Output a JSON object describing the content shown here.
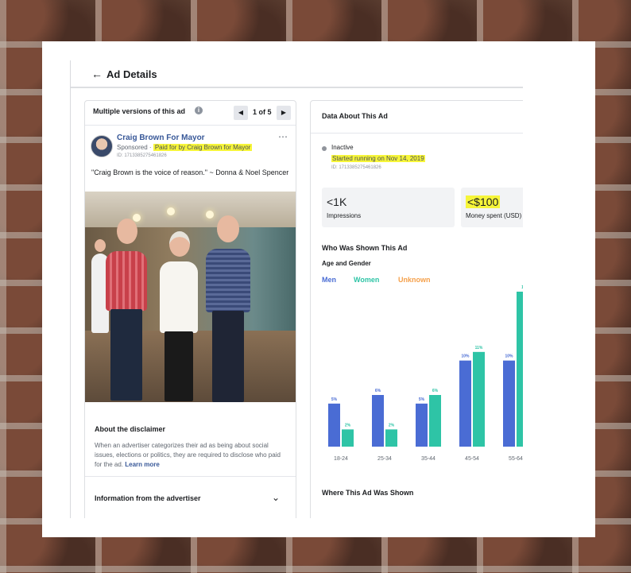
{
  "header": {
    "back_icon": "arrow-left-icon",
    "title": "Ad Details"
  },
  "versions": {
    "label": "Multiple versions of this ad",
    "count": "1 of 5"
  },
  "ad": {
    "advertiser": "Craig Brown For Mayor",
    "sponsored": "Sponsored · ",
    "paid_for": "Paid for by Craig Brown for Mayor",
    "id": "ID: 1713385275461826",
    "text": "\"Craig Brown is the voice of reason.\" ~ Donna & Noel Spencer"
  },
  "disclaimer": {
    "title": "About the disclaimer",
    "body": "When an advertiser categorizes their ad as being about social issues, elections or politics, they are required to disclose who paid for the ad. ",
    "learn_more": "Learn more"
  },
  "advertiser_info": {
    "title": "Information from the advertiser"
  },
  "data_panel": {
    "title": "Data About This Ad",
    "status": "Inactive",
    "started": "Started running on Nov 14, 2019",
    "id": "ID: 1713385275461826",
    "impressions_value": "<1K",
    "impressions_label": "Impressions",
    "spent_value": "<$100",
    "spent_label": "Money spent (USD)",
    "who_title": "Who Was Shown This Ad",
    "age_gender": "Age and Gender",
    "where_title": "Where This Ad Was Shown"
  },
  "legend": {
    "men": "Men",
    "women": "Women",
    "unknown": "Unknown"
  },
  "colors": {
    "men": "#4a6cd4",
    "women": "#2ec4a6",
    "unknown": "#f5a04a",
    "highlight": "#f6f53a"
  },
  "chart_data": {
    "type": "bar",
    "categories": [
      "18-24",
      "25-34",
      "35-44",
      "45-54",
      "55-64"
    ],
    "series": [
      {
        "name": "Men",
        "values": [
          5,
          6,
          5,
          10,
          10
        ],
        "labels": [
          "5%",
          "6%",
          "5%",
          "10%",
          "10%"
        ]
      },
      {
        "name": "Women",
        "values": [
          2,
          2,
          6,
          11,
          18
        ],
        "labels": [
          "2%",
          "2%",
          "6%",
          "11%",
          "1"
        ]
      }
    ],
    "ylim": [
      0,
      18
    ]
  }
}
